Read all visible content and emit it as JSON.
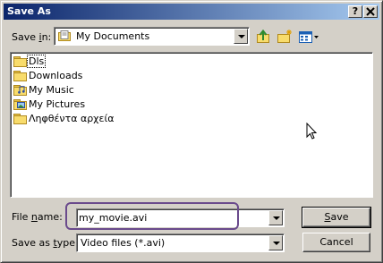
{
  "window": {
    "title": "Save As",
    "help_button": "?",
    "close_button": "X"
  },
  "save_in": {
    "label_pre": "Save ",
    "label_u": "i",
    "label_post": "n:",
    "value": "My Documents"
  },
  "toolbar": {
    "icons": [
      "up-folder-icon",
      "new-folder-icon",
      "view-menu-icon"
    ]
  },
  "files": [
    {
      "name": "Dls",
      "icon": "folder-icon",
      "selected": true
    },
    {
      "name": "Downloads",
      "icon": "folder-icon",
      "selected": false
    },
    {
      "name": "My Music",
      "icon": "music-folder-icon",
      "selected": false
    },
    {
      "name": "My Pictures",
      "icon": "pictures-folder-icon",
      "selected": false
    },
    {
      "name": "Ληφθέντα αρχεία",
      "icon": "folder-icon",
      "selected": false
    }
  ],
  "file_name": {
    "label_pre": "File ",
    "label_u": "n",
    "label_post": "ame:",
    "value": "my_movie.avi"
  },
  "save_as_type": {
    "label_pre": "Save as ",
    "label_u": "t",
    "label_post": "ype:",
    "value": "Video files (*.avi)"
  },
  "buttons": {
    "save_u": "S",
    "save_rest": "ave",
    "cancel": "Cancel"
  },
  "colors": {
    "title_start": "#0a246a",
    "title_end": "#a6caf0",
    "face": "#d4d0c8",
    "highlight_ring": "#6a4a8c"
  }
}
